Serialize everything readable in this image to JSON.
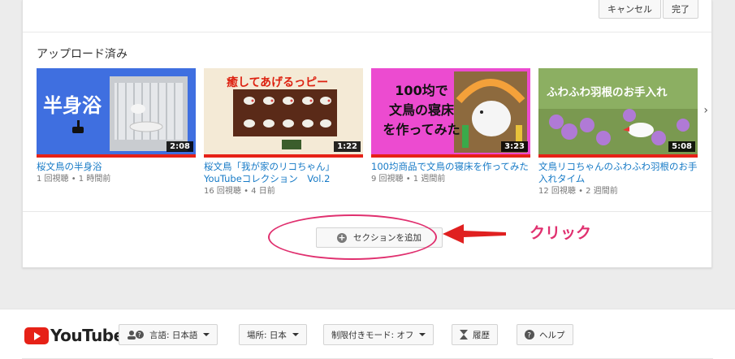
{
  "top_actions": {
    "cancel_label": "キャンセル",
    "done_label": "完了"
  },
  "section": {
    "title": "アップロード済み"
  },
  "videos": [
    {
      "thumb_text": "半身浴",
      "duration": "2:08",
      "title": "桜文鳥の半身浴",
      "meta": "1 回視聴 • 1 時間前"
    },
    {
      "thumb_text": "癒してあげるっピー",
      "duration": "1:22",
      "title": "桜文鳥「我が家のリコちゃん」YouTubeコレクション　Vol.2",
      "meta": "16 回視聴 • 4 日前"
    },
    {
      "thumb_text_1": "100均で",
      "thumb_text_2": "文鳥の寝床",
      "thumb_text_3": "を作ってみた",
      "duration": "3:23",
      "title": "100均商品で文鳥の寝床を作ってみた",
      "meta": "9 回視聴 • 1 週間前"
    },
    {
      "thumb_text": "ふわふわ羽根のお手入れ",
      "duration": "5:08",
      "title": "文鳥リコちゃんのふわふわ羽根のお手入れタイム",
      "meta": "12 回視聴 • 2 週間前"
    }
  ],
  "add_section": {
    "label": "セクションを追加"
  },
  "annotation": {
    "label": "クリック",
    "color": "#e0306f"
  },
  "footer": {
    "logo_text": "YouTube",
    "language": "言語: 日本語",
    "location": "場所: 日本",
    "restricted": "制限付きモード: オフ",
    "history": "履歴",
    "help": "ヘルプ"
  },
  "colors": {
    "accent_red": "#e62117",
    "link_blue": "#167ac6"
  }
}
